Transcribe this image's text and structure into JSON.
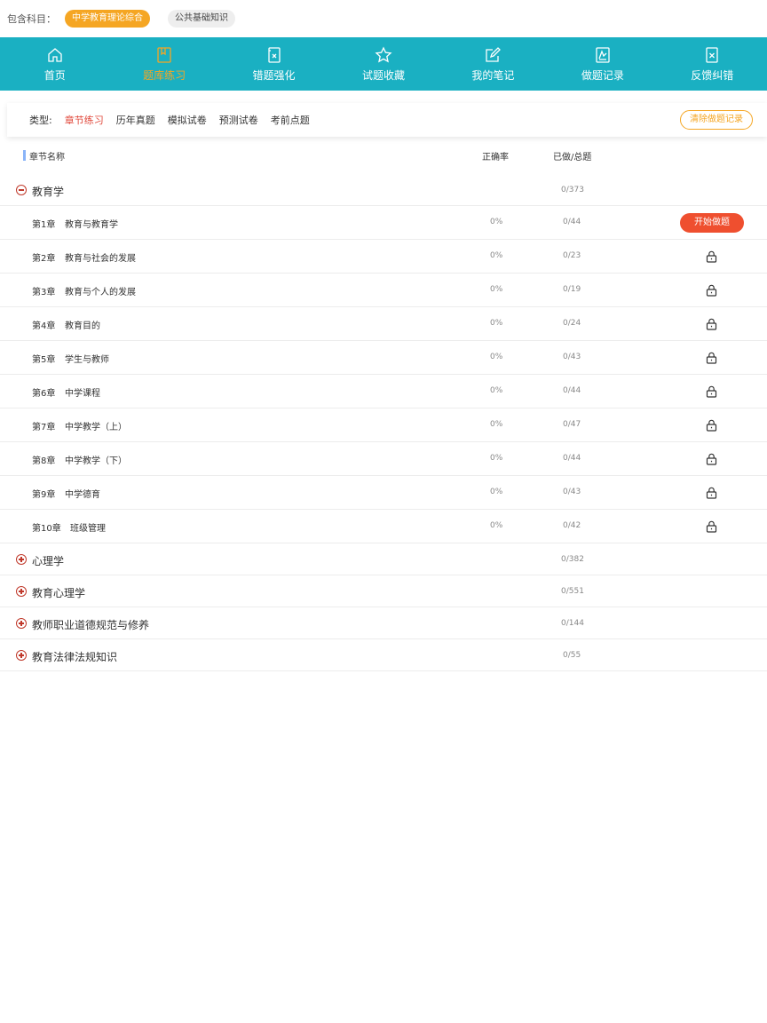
{
  "subjects": {
    "label": "包含科目：",
    "items": [
      {
        "label": "中学教育理论综合",
        "active": true
      },
      {
        "label": "公共基础知识",
        "active": false
      }
    ]
  },
  "nav": {
    "items": [
      {
        "label": "首页",
        "icon": "home-icon"
      },
      {
        "label": "题库练习",
        "icon": "book-icon",
        "active": true
      },
      {
        "label": "错题强化",
        "icon": "wrong-icon"
      },
      {
        "label": "试题收藏",
        "icon": "star-icon"
      },
      {
        "label": "我的笔记",
        "icon": "note-icon"
      },
      {
        "label": "做题记录",
        "icon": "chart-icon"
      },
      {
        "label": "反馈纠错",
        "icon": "feedback-icon"
      }
    ]
  },
  "types": {
    "label": "类型:",
    "tabs": [
      "章节练习",
      "历年真题",
      "模拟试卷",
      "预测试卷",
      "考前点题"
    ],
    "active_index": 0,
    "clear_label": "清除做题记录"
  },
  "table": {
    "headers": {
      "name": "章节名称",
      "rate": "正确率",
      "done": "已做/总题"
    }
  },
  "groups": [
    {
      "name": "教育学",
      "done": "0/373",
      "expanded": true,
      "chapters": [
        {
          "num": "第1章",
          "name": "教育与教育学",
          "rate": "0%",
          "done": "0/44",
          "action": "开始做题"
        },
        {
          "num": "第2章",
          "name": "教育与社会的发展",
          "rate": "0%",
          "done": "0/23",
          "locked": true
        },
        {
          "num": "第3章",
          "name": "教育与个人的发展",
          "rate": "0%",
          "done": "0/19",
          "locked": true
        },
        {
          "num": "第4章",
          "name": "教育目的",
          "rate": "0%",
          "done": "0/24",
          "locked": true
        },
        {
          "num": "第5章",
          "name": "学生与教师",
          "rate": "0%",
          "done": "0/43",
          "locked": true
        },
        {
          "num": "第6章",
          "name": "中学课程",
          "rate": "0%",
          "done": "0/44",
          "locked": true
        },
        {
          "num": "第7章",
          "name": "中学教学（上）",
          "rate": "0%",
          "done": "0/47",
          "locked": true
        },
        {
          "num": "第8章",
          "name": "中学教学（下）",
          "rate": "0%",
          "done": "0/44",
          "locked": true
        },
        {
          "num": "第9章",
          "name": "中学德育",
          "rate": "0%",
          "done": "0/43",
          "locked": true
        },
        {
          "num": "第10章",
          "name": "班级管理",
          "rate": "0%",
          "done": "0/42",
          "locked": true
        }
      ]
    },
    {
      "name": "心理学",
      "done": "0/382",
      "expanded": false
    },
    {
      "name": "教育心理学",
      "done": "0/551",
      "expanded": false
    },
    {
      "name": "教师职业道德规范与修养",
      "done": "0/144",
      "expanded": false
    },
    {
      "name": "教育法律法规知识",
      "done": "0/55",
      "expanded": false
    }
  ],
  "colors": {
    "nav_bg": "#1ab0c2",
    "accent_orange": "#f5a623",
    "active_tab_red": "#e0473a",
    "start_button": "#ef4f2f"
  }
}
